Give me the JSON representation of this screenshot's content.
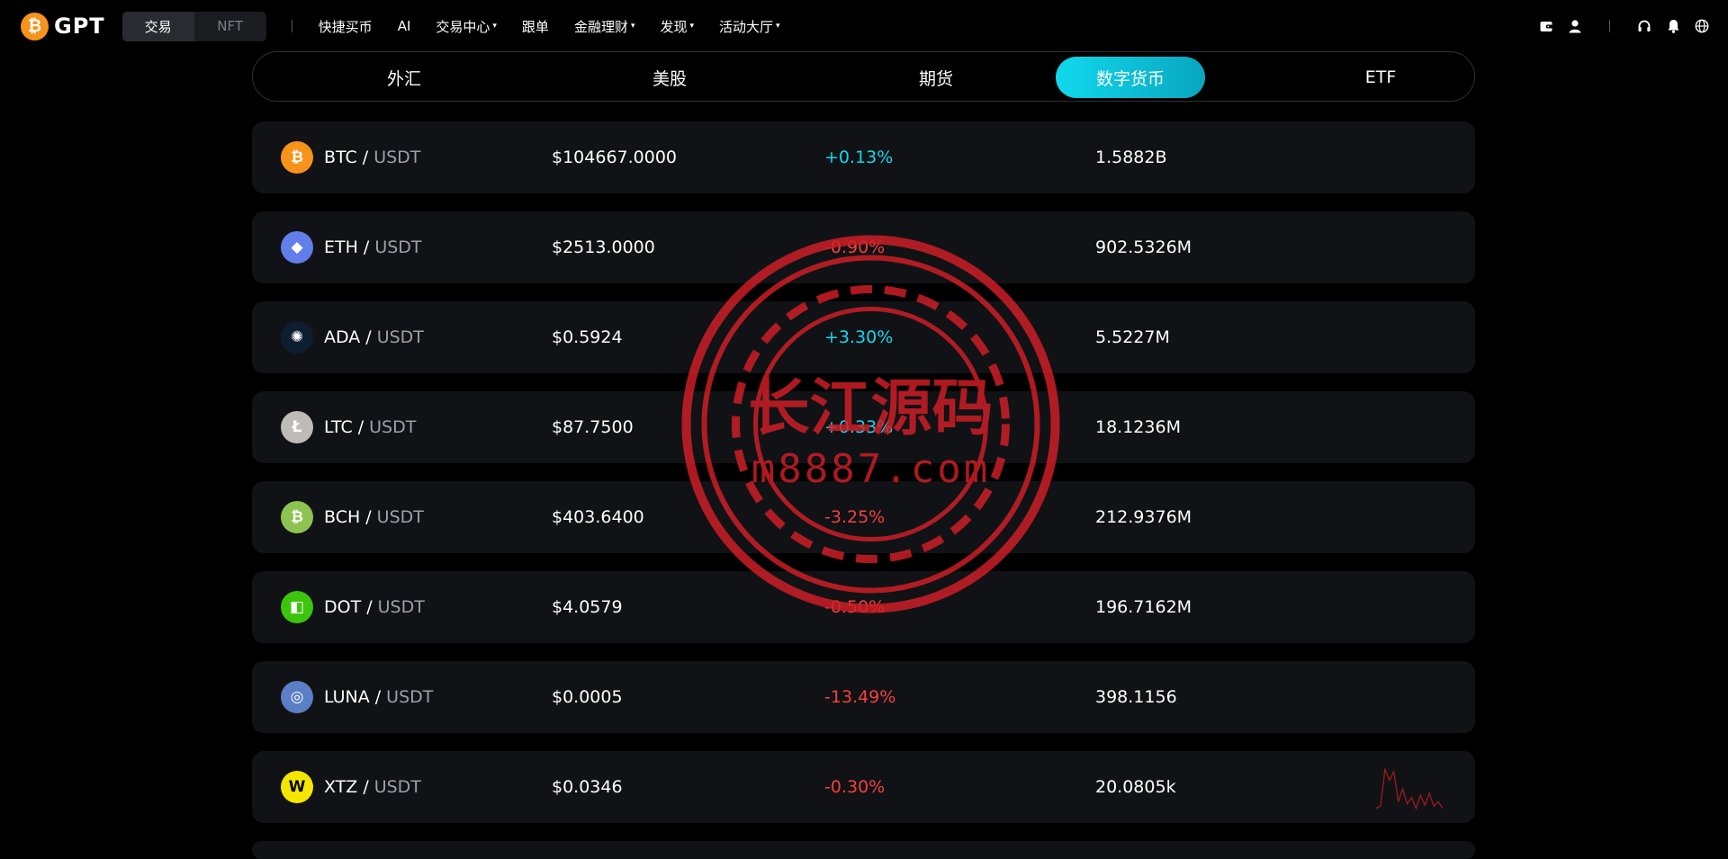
{
  "header": {
    "logo_symbol": "₿",
    "logo_text": "GPT",
    "modes": [
      "交易",
      "NFT"
    ],
    "nav": [
      {
        "label": "快捷买币",
        "dropdown": false
      },
      {
        "label": "AI",
        "dropdown": false
      },
      {
        "label": "交易中心",
        "dropdown": true
      },
      {
        "label": "跟单",
        "dropdown": false
      },
      {
        "label": "金融理财",
        "dropdown": true
      },
      {
        "label": "发现",
        "dropdown": true
      },
      {
        "label": "活动大厅",
        "dropdown": true
      }
    ],
    "right_icons": [
      "wallet-icon",
      "user-icon",
      "headset-icon",
      "bell-icon",
      "globe-icon"
    ],
    "caret": "▾"
  },
  "tabs": [
    "外汇",
    "美股",
    "期货",
    "数字货币",
    "ETF"
  ],
  "active_tab": "数字货币",
  "markets": [
    {
      "base": "BTC",
      "quote": "USDT",
      "sep": "/",
      "price": "$104667.0000",
      "change": "+0.13%",
      "direction": "up",
      "volume": "1.5882B",
      "icon": "bitcoin-icon",
      "glyph": "₿",
      "color": "#f7931a"
    },
    {
      "base": "ETH",
      "quote": "USDT",
      "sep": "/",
      "price": "$2513.0000",
      "change": "-0.90%",
      "direction": "down",
      "volume": "902.5326M",
      "icon": "ethereum-icon",
      "glyph": "◆",
      "color": "#627eea"
    },
    {
      "base": "ADA",
      "quote": "USDT",
      "sep": "/",
      "price": "$0.5924",
      "change": "+3.30%",
      "direction": "up",
      "volume": "5.5227M",
      "icon": "cardano-icon",
      "glyph": "✺",
      "color": "#0d1e30"
    },
    {
      "base": "LTC",
      "quote": "USDT",
      "sep": "/",
      "price": "$87.7500",
      "change": "+0.33%",
      "direction": "up",
      "volume": "18.1236M",
      "icon": "litecoin-icon",
      "glyph": "Ł",
      "color": "#bfbbbb"
    },
    {
      "base": "BCH",
      "quote": "USDT",
      "sep": "/",
      "price": "$403.6400",
      "change": "-3.25%",
      "direction": "down",
      "volume": "212.9376M",
      "icon": "bitcoin-cash-icon",
      "glyph": "₿",
      "color": "#8dc351"
    },
    {
      "base": "DOT",
      "quote": "USDT",
      "sep": "/",
      "price": "$4.0579",
      "change": "-0.50%",
      "direction": "down",
      "volume": "196.7162M",
      "icon": "polkadot-icon",
      "glyph": "◧",
      "color": "#3ec40c"
    },
    {
      "base": "LUNA",
      "quote": "USDT",
      "sep": "/",
      "price": "$0.0005",
      "change": "-13.49%",
      "direction": "down",
      "volume": "398.1156",
      "icon": "luna-icon",
      "glyph": "◎",
      "color": "#5a7fc4"
    },
    {
      "base": "XTZ",
      "quote": "USDT",
      "sep": "/",
      "price": "$0.0346",
      "change": "-0.30%",
      "direction": "down",
      "volume": "20.0805k",
      "icon": "tezos-icon",
      "glyph": "W",
      "color": "#f5e600"
    }
  ],
  "sparkline": {
    "color": "#a11a1c",
    "values": [
      0.05,
      0.1,
      0.95,
      0.7,
      0.9,
      0.2,
      0.5,
      0.15,
      0.3,
      0.05,
      0.35,
      0.12,
      0.4,
      0.1,
      0.2,
      0.05
    ]
  },
  "watermark": {
    "title": "长江源码",
    "subtitle": "m8887.com",
    "color": "#d41f27"
  }
}
